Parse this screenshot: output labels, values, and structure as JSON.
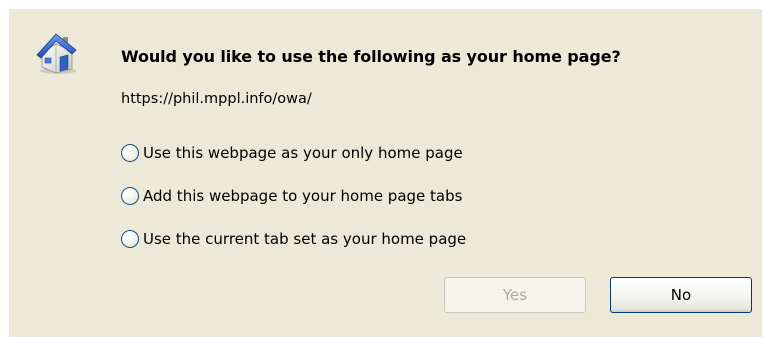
{
  "dialog": {
    "question": "Would you like to use the following as your home page?",
    "url": "https://phil.mppl.info/owa/",
    "icon": "home-icon",
    "options": [
      {
        "label": "Use this webpage as your only home page",
        "selected": false
      },
      {
        "label": "Add this webpage to your home page tabs",
        "selected": false
      },
      {
        "label": "Use the current tab set as your home page",
        "selected": false
      }
    ],
    "buttons": {
      "yes": {
        "label": "Yes",
        "enabled": false
      },
      "no": {
        "label": "No",
        "enabled": true
      }
    }
  },
  "colors": {
    "dialog_background": "#ece9d8",
    "radio_border": "#1c5180",
    "focused_button_border": "#003c74",
    "disabled_text": "#aca899"
  }
}
